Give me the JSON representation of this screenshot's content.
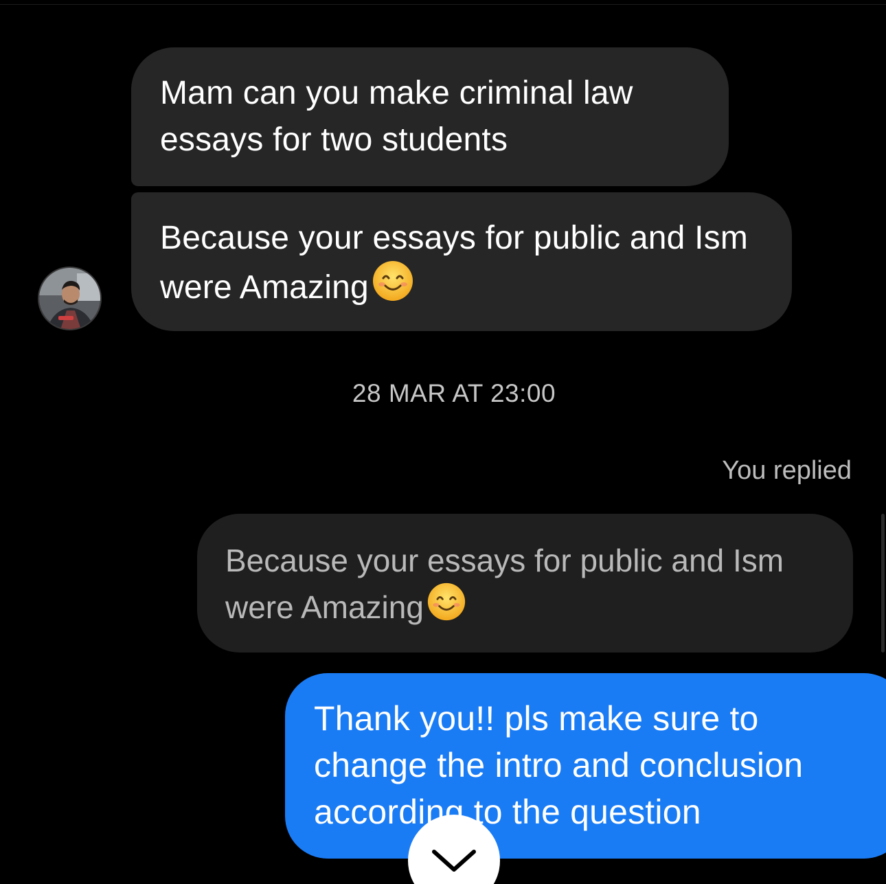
{
  "conversation": {
    "incoming": [
      {
        "text": "Mam can you make criminal law essays for two students"
      },
      {
        "text": "Because your essays for public and Ism were Amazing",
        "emoji": "smiling-face-emoji"
      }
    ],
    "timestamp": "28 MAR AT 23:00",
    "reply": {
      "label": "You replied",
      "quoted_text": "Because your essays for public and Ism were Amazing",
      "quoted_emoji": "smiling-face-emoji",
      "message": "Thank you!! pls make sure to change the intro and conclusion according to the question"
    }
  },
  "icons": {
    "scroll_down": "chevron-down-icon",
    "avatar": "sender-avatar"
  },
  "colors": {
    "background": "#000000",
    "incoming_bubble": "#262626",
    "quoted_bubble": "#1f1f1f",
    "outgoing_bubble": "#1a7cf5",
    "timestamp_text": "#c7c7c7"
  }
}
